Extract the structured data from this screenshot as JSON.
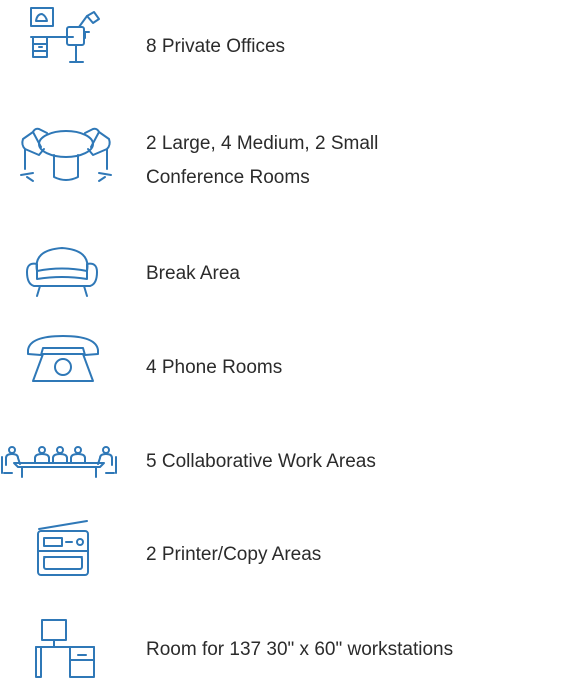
{
  "features": [
    {
      "icon": "private-office-icon",
      "label": "8 Private Offices"
    },
    {
      "icon": "conference-room-icon",
      "label_line1": "2 Large, 4 Medium, 2 Small",
      "label_line2": "Conference Rooms"
    },
    {
      "icon": "sofa-icon",
      "label": "Break Area"
    },
    {
      "icon": "phone-icon",
      "label": "4 Phone Rooms"
    },
    {
      "icon": "collaborative-work-icon",
      "label": "5 Collaborative Work Areas"
    },
    {
      "icon": "printer-icon",
      "label": "2 Printer/Copy Areas"
    },
    {
      "icon": "workstation-icon",
      "label": "Room for 137 30\" x 60\" workstations"
    }
  ],
  "colors": {
    "icon": "#2f78b7",
    "text": "#2b2b2b",
    "background": "#ffffff"
  }
}
